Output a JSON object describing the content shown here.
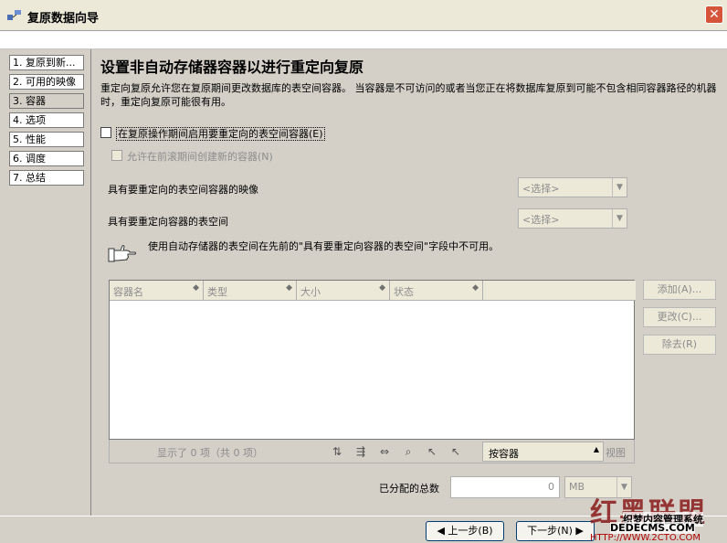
{
  "window": {
    "title": "复原数据向导",
    "close_glyph": "✕"
  },
  "nav": {
    "items": [
      {
        "label": "1. 复原到新..."
      },
      {
        "label": "2. 可用的映像"
      },
      {
        "label": "3. 容器"
      },
      {
        "label": "4. 选项"
      },
      {
        "label": "5. 性能"
      },
      {
        "label": "6. 调度"
      },
      {
        "label": "7. 总结"
      }
    ],
    "active_index": 2
  },
  "main": {
    "heading": "设置非自动存储器容器以进行重定向复原",
    "description": "重定向复原允许您在复原期间更改数据库的表空间容器。 当容器是不可访问的或者当您正在将数据库复原到可能不包含相同容器路径的机器时，重定向复原可能很有用。",
    "enable_redirect_label": "在复原操作期间启用要重定向的表空间容器(E)",
    "allow_create_label": "允许在前滚期间创建新的容器(N)",
    "image_label": "具有要重定向的表空间容器的映像",
    "image_select": "<选择>",
    "tablespace_label": "具有要重定向容器的表空间",
    "tablespace_select": "<选择>",
    "note": "使用自动存储器的表空间在先前的\"具有要重定向容器的表空间\"字段中不可用。",
    "grid": {
      "columns": [
        "容器名",
        "类型",
        "大小",
        "状态"
      ],
      "status": "显示了 0 项（共 0 项）",
      "sort_by": "按容器",
      "view": "视图"
    },
    "buttons": {
      "add": "添加(A)...",
      "change": "更改(C)...",
      "remove": "除去(R)"
    },
    "total_label": "已分配的总数",
    "total_value": "0",
    "unit": "MB"
  },
  "footer": {
    "back": "◀ 上一步(B)",
    "next": "下一步(N) ▶"
  },
  "watermark": {
    "big": "红黑联盟",
    "line1": "织梦内容管理系统",
    "line2": "DEDECMS.COM",
    "line3": "HTTP://WWW.2CTO.COM"
  }
}
